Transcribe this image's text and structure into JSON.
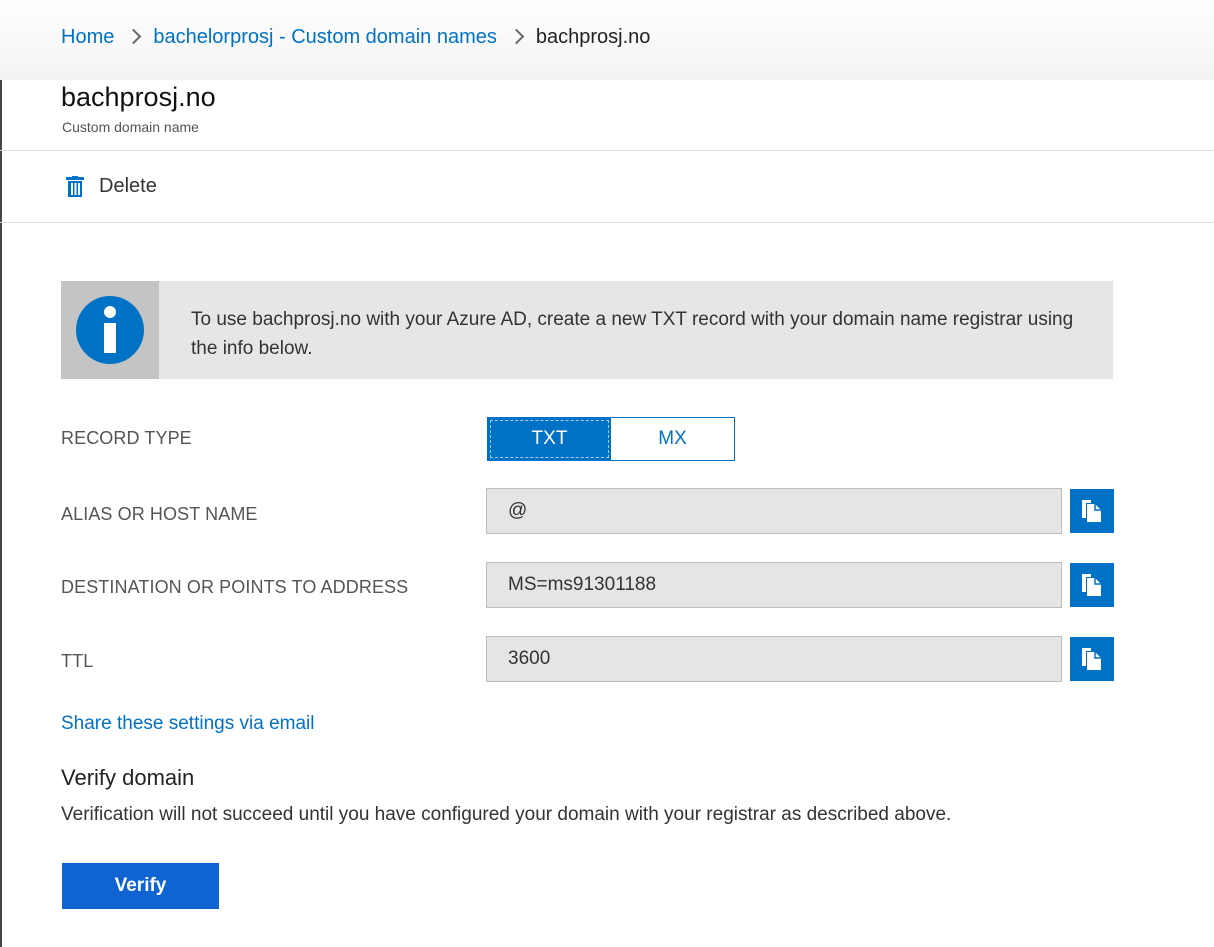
{
  "breadcrumb": {
    "home": "Home",
    "parent": "bachelorprosj - Custom domain names",
    "current": "bachprosj.no"
  },
  "header": {
    "title": "bachprosj.no",
    "subtitle": "Custom domain name"
  },
  "toolbar": {
    "delete_label": "Delete"
  },
  "info": {
    "text": "To use bachprosj.no with your Azure AD, create a new TXT record with your domain name registrar using the info below."
  },
  "form": {
    "record_type": {
      "label": "RECORD TYPE",
      "options": [
        "TXT",
        "MX"
      ],
      "selected": "TXT"
    },
    "alias": {
      "label": "ALIAS OR HOST NAME",
      "value": "@"
    },
    "destination": {
      "label": "DESTINATION OR POINTS TO ADDRESS",
      "value": "MS=ms91301188"
    },
    "ttl": {
      "label": "TTL",
      "value": "3600"
    }
  },
  "share_link": "Share these settings via email",
  "verify": {
    "title": "Verify domain",
    "description": "Verification will not succeed until you have configured your domain with your registrar as described above.",
    "button_label": "Verify"
  },
  "colors": {
    "accent": "#0072c6",
    "verify_button": "#0f64d2",
    "banner_bg": "#e6e6e6",
    "field_bg": "#e5e5e5"
  },
  "icons": {
    "delete": "trash-icon",
    "info": "info-icon",
    "copy": "copy-icon"
  }
}
